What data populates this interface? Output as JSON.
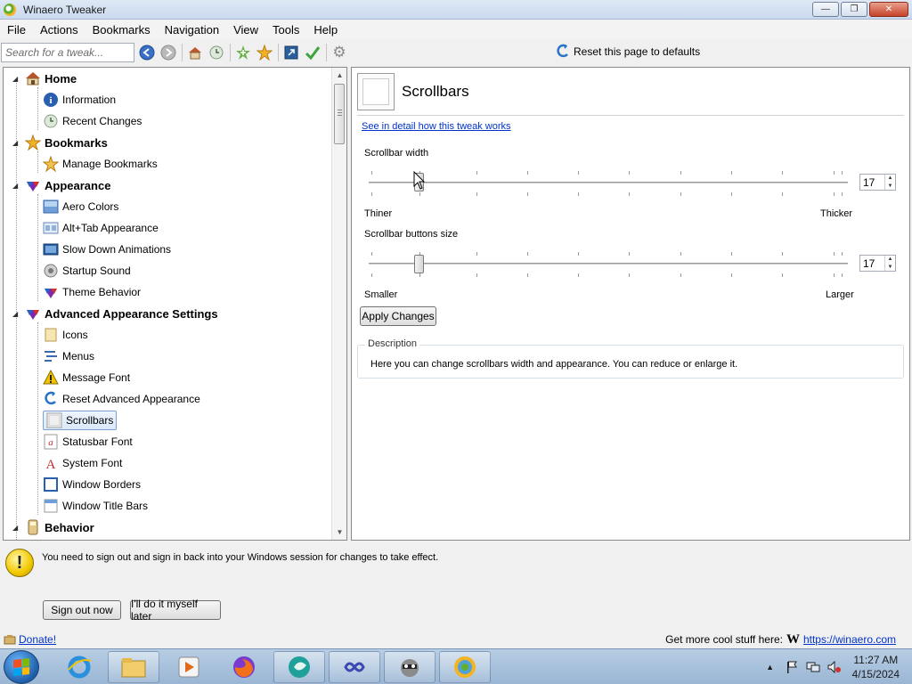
{
  "window": {
    "title": "Winaero Tweaker"
  },
  "menu": [
    "File",
    "Actions",
    "Bookmarks",
    "Navigation",
    "View",
    "Tools",
    "Help"
  ],
  "toolbar": {
    "search_placeholder": "Search for a tweak...",
    "reset_label": "Reset this page to defaults"
  },
  "tree": {
    "home": "Home",
    "information": "Information",
    "recent_changes": "Recent Changes",
    "bookmarks": "Bookmarks",
    "manage_bookmarks": "Manage Bookmarks",
    "appearance": "Appearance",
    "aero_colors": "Aero Colors",
    "alt_tab": "Alt+Tab Appearance",
    "slow_down": "Slow Down Animations",
    "startup_sound": "Startup Sound",
    "theme_behavior": "Theme Behavior",
    "advanced_appearance": "Advanced Appearance Settings",
    "icons": "Icons",
    "menus": "Menus",
    "message_font": "Message Font",
    "reset_advanced": "Reset Advanced Appearance",
    "scrollbars": "Scrollbars",
    "statusbar_font": "Statusbar Font",
    "system_font": "System Font",
    "window_borders": "Window Borders",
    "window_title_bars": "Window Title Bars",
    "behavior": "Behavior"
  },
  "page": {
    "title": "Scrollbars",
    "detail_link": "See in detail how this tweak works",
    "width_label": "Scrollbar width",
    "width_value": "17",
    "width_min_label": "Thiner",
    "width_max_label": "Thicker",
    "buttons_label": "Scrollbar buttons size",
    "buttons_value": "17",
    "buttons_min_label": "Smaller",
    "buttons_max_label": "Larger",
    "apply_label": "Apply Changes",
    "description_legend": "Description",
    "description_text": "Here you can change scrollbars width and appearance. You can reduce or enlarge it."
  },
  "notice": {
    "text": "You need to sign out and sign in back into your Windows session for changes to take effect.",
    "sign_out": "Sign out now",
    "later": "I'll do it myself later"
  },
  "footer": {
    "donate": "Donate!",
    "more_text": "Get more cool stuff here:",
    "w_glyph": "W",
    "url": "https://winaero.com"
  },
  "taskbar": {
    "time": "11:27 AM",
    "date": "4/15/2024"
  }
}
